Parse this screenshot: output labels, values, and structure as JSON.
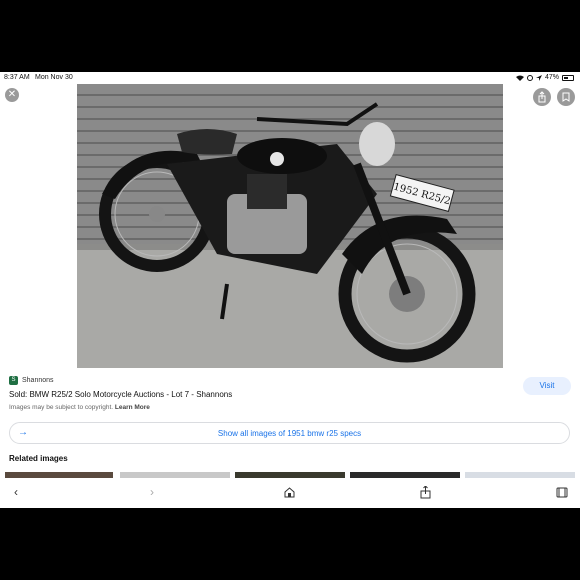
{
  "status": {
    "time": "8:37 AM",
    "date": "Mon Nov 30",
    "battery": "47%",
    "battery_fraction": 0.47
  },
  "viewer": {
    "close_icon": "close-icon",
    "share_icon": "share-icon",
    "bookmark_icon": "bookmark-icon"
  },
  "photo": {
    "plate_text": "1952 R25/2"
  },
  "result": {
    "source": "Shannons",
    "title": "Sold: BMW R25/2 Solo Motorcycle Auctions - Lot 7 - Shannons",
    "copyright": "Images may be subject to copyright.",
    "learn_more": "Learn More",
    "visit_label": "Visit"
  },
  "show_all": {
    "label": "Show all images of 1951 bmw r25 specs"
  },
  "related": {
    "heading": "Related images"
  },
  "colors": {
    "accent": "#1a73e8",
    "visit_bg": "#e8f0fe",
    "source_brand": "#1f6f43"
  },
  "toolbar": {
    "icons": [
      "back-icon",
      "forward-icon",
      "home-icon",
      "share-icon",
      "tabs-icon"
    ]
  }
}
